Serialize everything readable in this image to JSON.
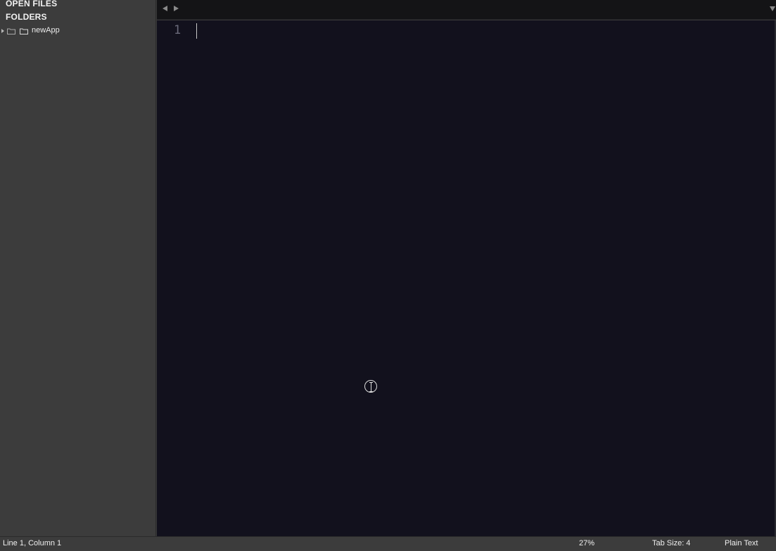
{
  "sidebar": {
    "open_files_heading": "OPEN FILES",
    "folders_heading": "FOLDERS",
    "folders": [
      {
        "label": "newApp",
        "icon": "folder-icon",
        "expanded": false
      }
    ]
  },
  "tabbar": {
    "nav_back_icon": "chevron-left-icon",
    "nav_forward_icon": "chevron-right-icon",
    "dropdown_icon": "chevron-down-icon"
  },
  "editor": {
    "line_numbers": [
      "1"
    ],
    "content": "",
    "background": "#12111d"
  },
  "statusbar": {
    "position": "Line 1, Column 1",
    "zoom": "27%",
    "tab_size": "Tab Size: 4",
    "syntax": "Plain Text"
  },
  "colors": {
    "sidebar_bg": "#3c3c3c",
    "editor_bg": "#12111d",
    "tabbar_bg": "#141416"
  }
}
